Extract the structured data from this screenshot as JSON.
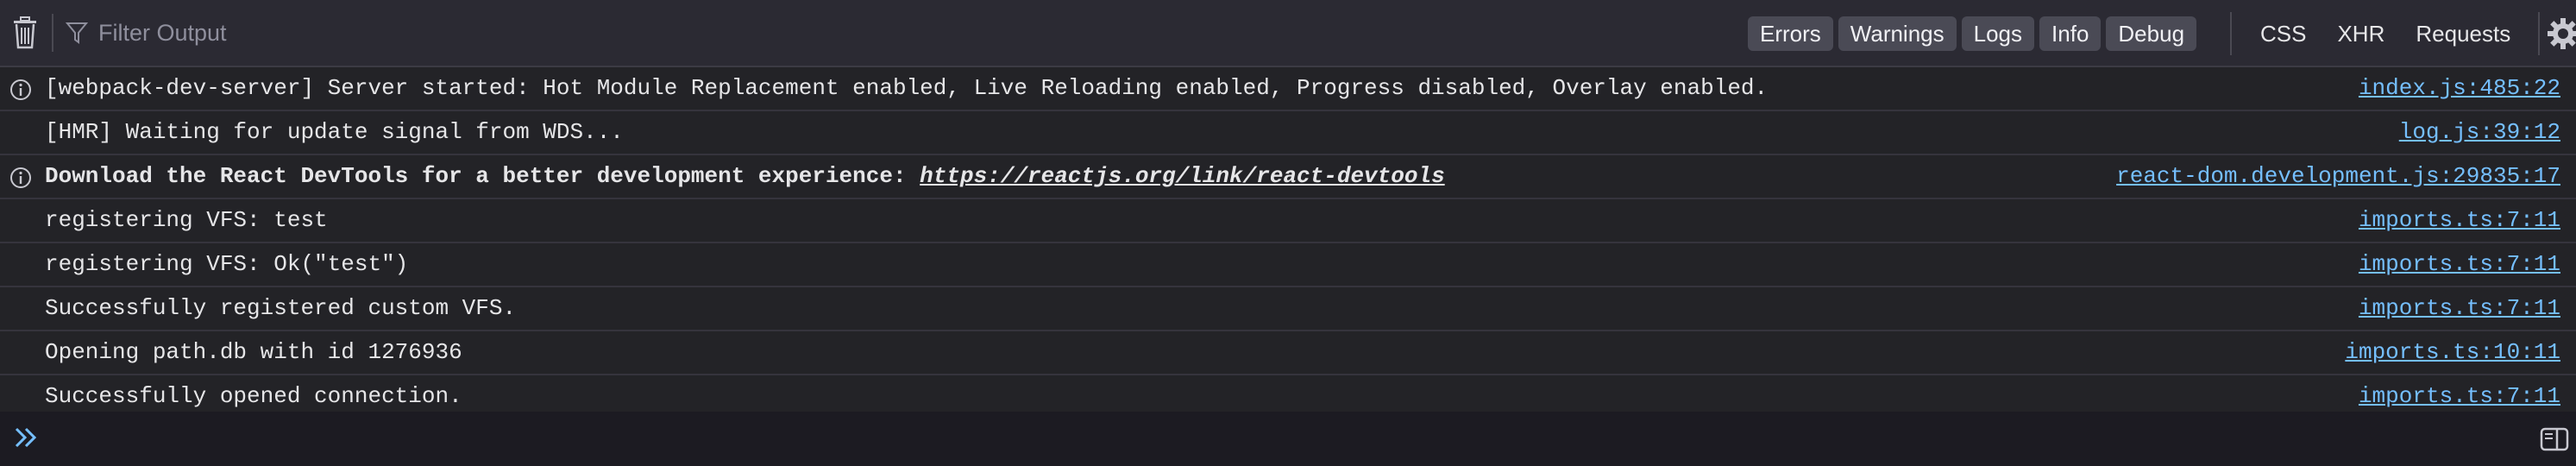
{
  "toolbar": {
    "filter_placeholder": "Filter Output",
    "filters": [
      "Errors",
      "Warnings",
      "Logs",
      "Info",
      "Debug"
    ],
    "requests": [
      "CSS",
      "XHR",
      "Requests"
    ]
  },
  "logs": [
    {
      "type": "info",
      "message": "[webpack-dev-server] Server started: Hot Module Replacement enabled, Live Reloading enabled, Progress disabled, Overlay enabled.",
      "source": "index.js:485:22"
    },
    {
      "type": "log",
      "message": "[HMR] Waiting for update signal from WDS...",
      "source": "log.js:39:12"
    },
    {
      "type": "info",
      "message": "Download the React DevTools for a better development experience: ",
      "link": "https://reactjs.org/link/react-devtools",
      "source": "react-dom.development.js:29835:17"
    },
    {
      "type": "log",
      "message": "registering VFS: test",
      "source": "imports.ts:7:11"
    },
    {
      "type": "log",
      "message": "registering VFS: Ok(\"test\")",
      "source": "imports.ts:7:11"
    },
    {
      "type": "log",
      "message": "Successfully registered custom VFS.",
      "source": "imports.ts:7:11"
    },
    {
      "type": "log",
      "message": "Opening path.db with id 1276936",
      "source": "imports.ts:10:11"
    },
    {
      "type": "log",
      "message": "Successfully opened connection.",
      "source": "imports.ts:7:11"
    }
  ]
}
